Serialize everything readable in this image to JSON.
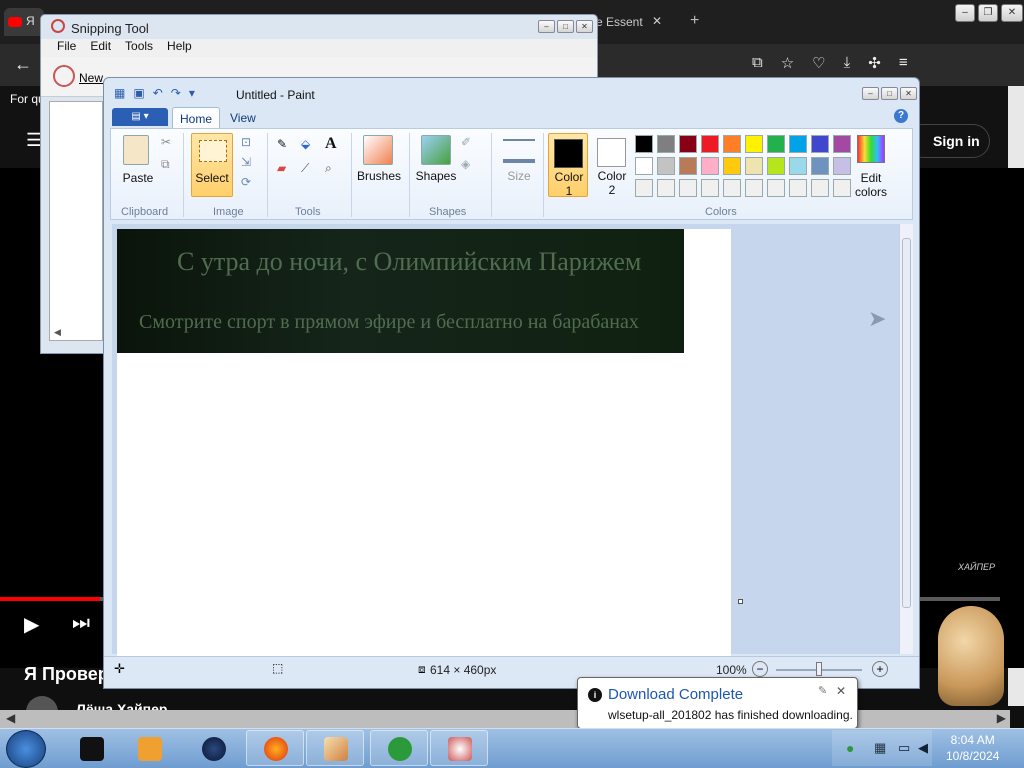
{
  "browser": {
    "tab1_label": "Я",
    "tab2_label": "ve Essent",
    "tab2_close": "✕",
    "new_tab": "+",
    "win_min": "–",
    "win_max": "❐",
    "win_close": "✕",
    "back": "←",
    "for_q": "For qu"
  },
  "youtube": {
    "signin": "Sign in",
    "video_title": "Я Провер",
    "channel": "Лёша Хайпер",
    "caption": "ХАЙПЕР",
    "progress_fraction": 0.1
  },
  "snipping": {
    "title": "Snipping Tool",
    "menu": [
      "File",
      "Edit",
      "Tools",
      "Help"
    ],
    "new_label": "New"
  },
  "paint": {
    "title": "Untitled - Paint",
    "tabs": {
      "home": "Home",
      "view": "View"
    },
    "help": "?",
    "groups": {
      "clipboard": "Clipboard",
      "image": "Image",
      "tools": "Tools",
      "shapes": "Shapes",
      "colors": "Colors"
    },
    "buttons": {
      "paste": "Paste",
      "select": "Select",
      "brushes": "Brushes",
      "shapes": "Shapes",
      "size": "Size",
      "color1": "Color",
      "color1_num": "1",
      "color2": "Color",
      "color2_num": "2",
      "edit_colors": "Edit",
      "edit_colors2": "colors"
    },
    "palette": [
      "#000000",
      "#7f7f7f",
      "#880015",
      "#ed1c24",
      "#ff7f27",
      "#fff200",
      "#22b14c",
      "#00a2e8",
      "#3f48cc",
      "#a349a4",
      "#ffffff",
      "#c3c3c3",
      "#b97a57",
      "#ffaec9",
      "#ffc90e",
      "#efe4b0",
      "#b5e61d",
      "#99d9ea",
      "#7092be",
      "#c8bfe7",
      "#f0f0f0",
      "#f0f0f0",
      "#f0f0f0",
      "#f0f0f0",
      "#f0f0f0",
      "#f0f0f0",
      "#f0f0f0",
      "#f0f0f0",
      "#f0f0f0",
      "#f0f0f0"
    ],
    "banner_line1": "С утра до ночи, с Олимпийским Парижем",
    "banner_line2": "Смотрите спорт в прямом эфире и бесплатно на барабанах",
    "status_dimensions": "614 × 460px",
    "zoom": "100%"
  },
  "toast": {
    "title": "Download Complete",
    "message": "wlsetup-all_201802 has finished downloading."
  },
  "taskbar": {
    "time": "8:04 AM",
    "date": "10/8/2024"
  }
}
